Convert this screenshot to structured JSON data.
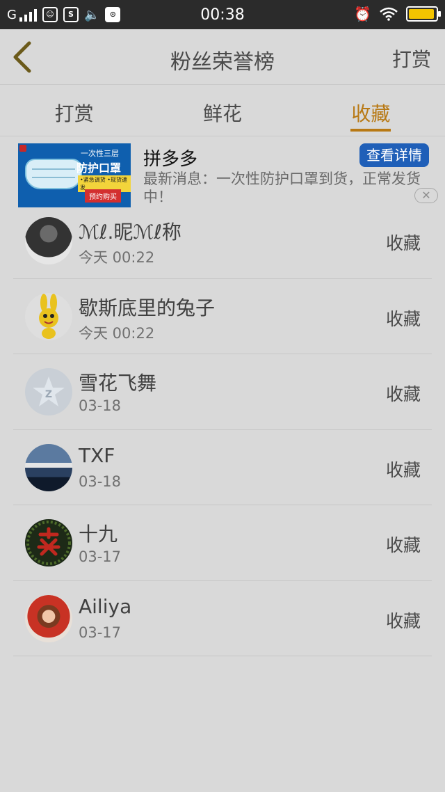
{
  "status_bar": {
    "network": "G",
    "time": "00:38",
    "battery_level": 0.85
  },
  "header": {
    "title": "粉丝荣誉榜",
    "right_action": "打赏"
  },
  "tabs": [
    {
      "label": "打赏",
      "active": false
    },
    {
      "label": "鲜花",
      "active": false
    },
    {
      "label": "收藏",
      "active": true
    }
  ],
  "ad": {
    "title": "拼多多",
    "button": "查看详情",
    "description": "最新消息：一次性防护口罩到货，正常发货中！",
    "image_text": {
      "line1": "一次性三层",
      "line2": "防护口罩",
      "line3": "•紧急调货 •现货速发",
      "button": "预约购买"
    },
    "close_icon": "close-icon"
  },
  "list": [
    {
      "name": "ℳℓ.昵ℳℓ称",
      "time": "今天 00:22",
      "action": "收藏"
    },
    {
      "name": "歇斯底里的兔子",
      "time": "今天 00:22",
      "action": "收藏"
    },
    {
      "name": "雪花飞舞",
      "time": "03-18",
      "action": "收藏"
    },
    {
      "name": "TXF",
      "time": "03-18",
      "action": "收藏"
    },
    {
      "name": "十九",
      "time": "03-17",
      "action": "收藏"
    },
    {
      "name": "Ailiya",
      "time": "03-17",
      "action": "收藏"
    }
  ],
  "colors": {
    "accent": "#b87914",
    "ad_button": "#1f5fb8",
    "background": "#d9d9d9"
  }
}
